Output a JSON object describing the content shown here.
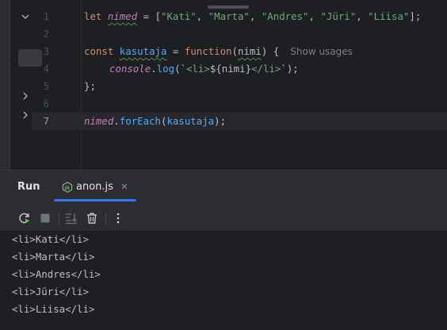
{
  "editor": {
    "line_numbers": [
      "1",
      "2",
      "3",
      "4",
      "5",
      "6",
      "7"
    ],
    "current_line": "7",
    "code": {
      "line1": {
        "kw_let": "let",
        "var": "nimed",
        "eq": " = [",
        "s1": "\"Kati\"",
        "c1": ", ",
        "s2": "\"Marta\"",
        "c2": ", ",
        "s3": "\"Andres\"",
        "c3": ", ",
        "s4": "\"Jüri\"",
        "c4": ", ",
        "s5": "\"Liisa\"",
        "end": "];"
      },
      "line3": {
        "kw_const": "const",
        "fn": "kasutaja",
        "eq": " = ",
        "kw_function": "function",
        "open": "(",
        "param": "nimi",
        "close": ") {",
        "inlay_hint": "Show usages"
      },
      "line4": {
        "obj": "console",
        "dot": ".",
        "method": "log",
        "open": "(`",
        "tmpl1": "<li>",
        "expr": "${nimi}",
        "tmpl2": "</li>",
        "close": "`);"
      },
      "line5": {
        "text": "};"
      },
      "line7": {
        "var": "nimed",
        "dot": ".",
        "method": "forEach",
        "open": "(",
        "arg": "kasutaja",
        "close": ");"
      }
    }
  },
  "run_panel": {
    "title": "Run",
    "tab": {
      "label": "anon.js",
      "icon": "js-file-icon"
    },
    "toolbar": {
      "rerun": "rerun-icon",
      "stop": "stop-icon",
      "scroll_to_end": "scroll-to-end-icon",
      "clear": "trash-icon",
      "more": "more-vertical-icon"
    },
    "output": [
      "<li>Kati</li>",
      "<li>Marta</li>",
      "<li>Andres</li>",
      "<li>Jüri</li>",
      "<li>Liisa</li>"
    ]
  },
  "colors": {
    "accent": "#3574f0",
    "keyword": "#cf8e6d",
    "string": "#6aab73",
    "variable": "#c77dbb",
    "function": "#56a8f5",
    "text": "#bcbec4",
    "background": "#1e1f22",
    "panel": "#2b2d30"
  }
}
